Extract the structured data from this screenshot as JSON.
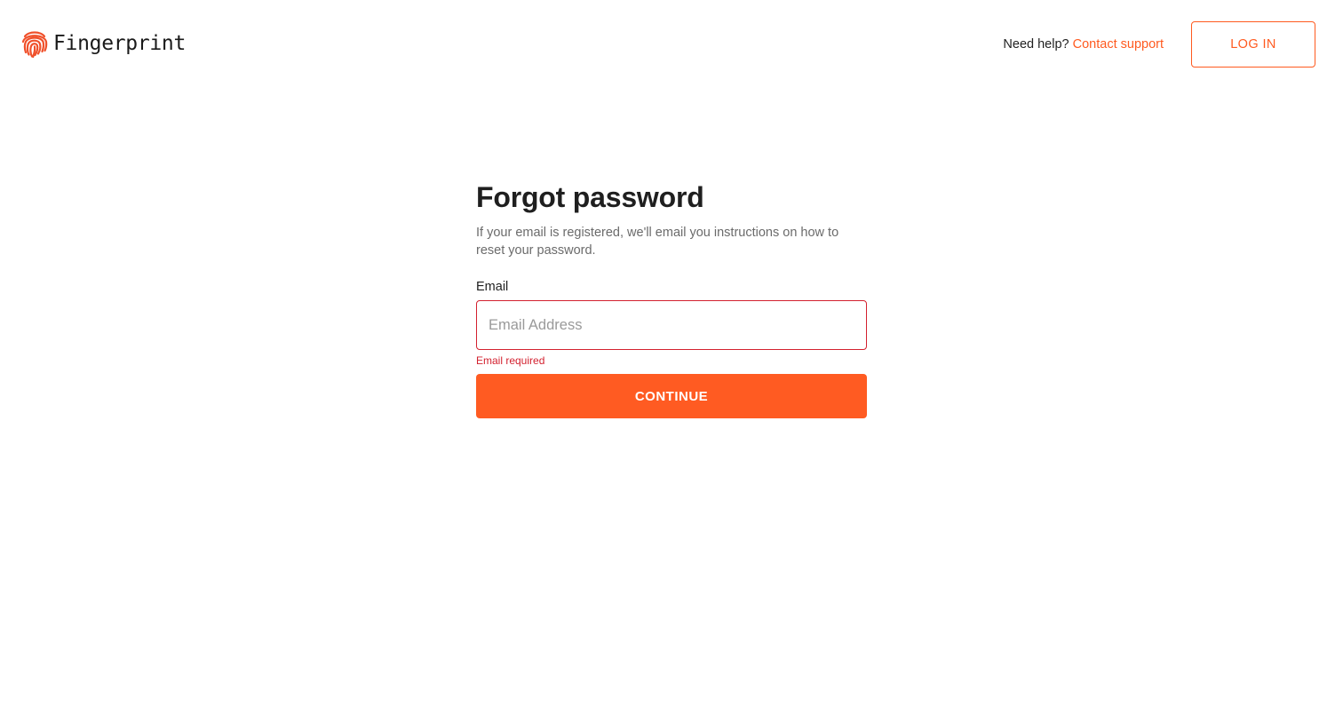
{
  "header": {
    "brand_name": "Fingerprint",
    "brand_icon": "fingerprint-icon",
    "help_prompt": "Need help?",
    "help_link": "Contact support",
    "login_label": "LOG IN"
  },
  "form": {
    "title": "Forgot password",
    "subtitle": "If your email is registered, we'll email you instructions on how to reset your password.",
    "email_label": "Email",
    "email_value": "",
    "email_placeholder": "Email Address",
    "email_error": "Email required",
    "continue_label": "CONTINUE"
  },
  "colors": {
    "accent": "#ff5a1f",
    "error": "#d3212f",
    "text": "#1f1f1f",
    "muted": "#6b6b6b"
  }
}
